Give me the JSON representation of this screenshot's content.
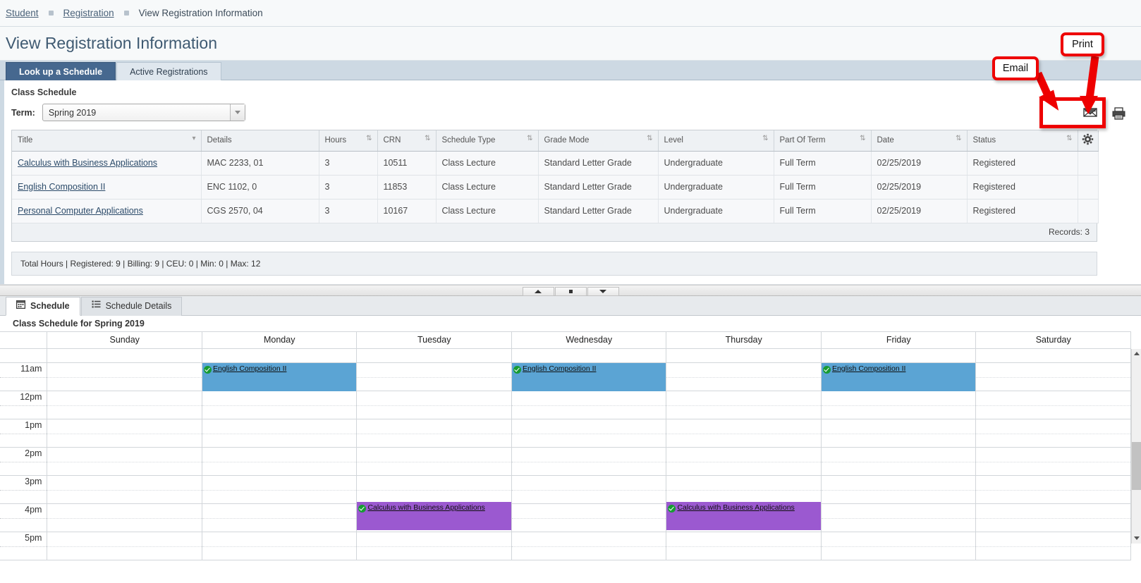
{
  "breadcrumb": {
    "items": [
      {
        "label": "Student",
        "link": true
      },
      {
        "label": "Registration",
        "link": true
      },
      {
        "label": "View Registration Information",
        "link": false
      }
    ]
  },
  "header": {
    "title": "View Registration Information"
  },
  "top_tabs": [
    {
      "label": "Look up a Schedule",
      "active": true
    },
    {
      "label": "Active Registrations",
      "active": false
    }
  ],
  "panel": {
    "caption": "Class Schedule",
    "term_label": "Term:",
    "term_value": "Spring 2019",
    "email_icon": "email-icon",
    "print_icon": "print-icon",
    "settings_icon": "gear-icon"
  },
  "grid": {
    "columns": [
      "Title",
      "Details",
      "Hours",
      "CRN",
      "Schedule Type",
      "Grade Mode",
      "Level",
      "Part Of Term",
      "Date",
      "Status"
    ],
    "rows": [
      {
        "title": "Calculus with Business Applications",
        "details": "MAC 2233, 01",
        "hours": "3",
        "crn": "10511",
        "schedule_type": "Class Lecture",
        "grade_mode": "Standard Letter Grade",
        "level": "Undergraduate",
        "part_of_term": "Full Term",
        "date": "02/25/2019",
        "status": "Registered"
      },
      {
        "title": "English Composition II",
        "details": "ENC 1102, 0",
        "hours": "3",
        "crn": "11853",
        "schedule_type": "Class Lecture",
        "grade_mode": "Standard Letter Grade",
        "level": "Undergraduate",
        "part_of_term": "Full Term",
        "date": "02/25/2019",
        "status": "Registered"
      },
      {
        "title": "Personal Computer Applications",
        "details": "CGS 2570, 04",
        "hours": "3",
        "crn": "10167",
        "schedule_type": "Class Lecture",
        "grade_mode": "Standard Letter Grade",
        "level": "Undergraduate",
        "part_of_term": "Full Term",
        "date": "02/25/2019",
        "status": "Registered"
      }
    ],
    "records_label": "Records: 3"
  },
  "totals": {
    "text": "Total Hours | Registered: 9 | Billing: 9 | CEU: 0 | Min: 0 | Max: 12"
  },
  "splitter": {
    "collapse_up": "triangle-up-icon",
    "restore": "square-dot-icon",
    "collapse_down": "triangle-down-icon"
  },
  "bottom_tabs": [
    {
      "label": "Schedule",
      "icon": "calendar-icon",
      "active": true
    },
    {
      "label": "Schedule Details",
      "icon": "list-icon",
      "active": false
    }
  ],
  "calendar": {
    "caption": "Class Schedule for Spring 2019",
    "days": [
      "Sunday",
      "Monday",
      "Tuesday",
      "Wednesday",
      "Thursday",
      "Friday",
      "Saturday"
    ],
    "times": [
      "11am",
      "12pm",
      "1pm",
      "2pm",
      "3pm",
      "4pm",
      "5pm"
    ],
    "events": [
      {
        "title": "English Composition II",
        "day": "Monday",
        "color": "#5ba4d4",
        "start": "11:00am",
        "status_icon": "check-circle-icon"
      },
      {
        "title": "English Composition II",
        "day": "Wednesday",
        "color": "#5ba4d4",
        "start": "11:00am",
        "status_icon": "check-circle-icon"
      },
      {
        "title": "English Composition II",
        "day": "Friday",
        "color": "#5ba4d4",
        "start": "11:00am",
        "status_icon": "check-circle-icon"
      },
      {
        "title": "Calculus with Business Applications",
        "day": "Tuesday",
        "color": "#9b59d0",
        "start": "3:55pm",
        "status_icon": "check-circle-icon"
      },
      {
        "title": "Calculus with Business Applications",
        "day": "Thursday",
        "color": "#9b59d0",
        "start": "3:55pm",
        "status_icon": "check-circle-icon"
      }
    ]
  },
  "annotations": [
    {
      "label": "Email",
      "target": "email-icon",
      "color": "#ee0000"
    },
    {
      "label": "Print",
      "target": "print-icon",
      "color": "#ee0000"
    }
  ]
}
